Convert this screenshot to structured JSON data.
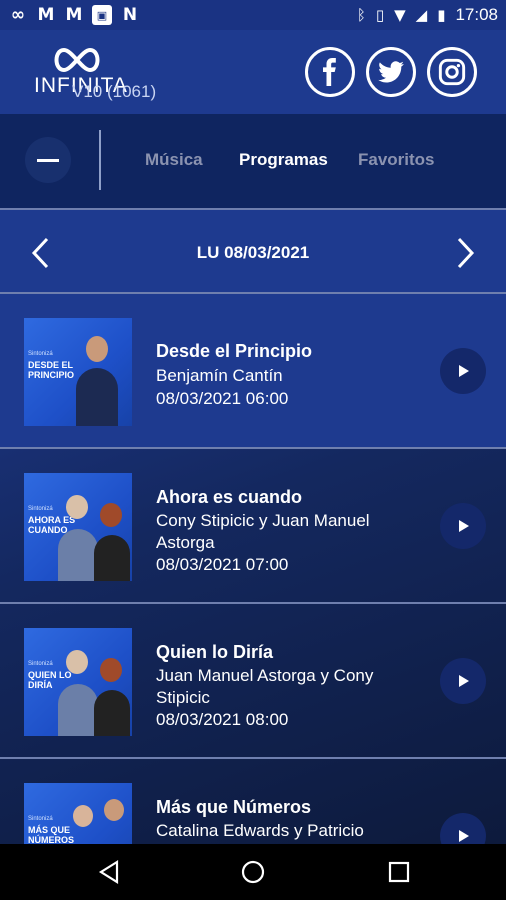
{
  "status": {
    "left_icons": [
      "infinity-icon",
      "gmail-icon",
      "gmail-icon",
      "image-icon",
      "n-icon"
    ],
    "right_icons": [
      "bluetooth-icon",
      "vibrate-icon",
      "wifi-icon",
      "signal-icon",
      "battery-icon"
    ],
    "time": "17:08"
  },
  "header": {
    "logo_text": "INFINITA",
    "version": "V10 (1061)",
    "social": [
      "facebook-icon",
      "twitter-icon",
      "instagram-icon"
    ]
  },
  "tabs": {
    "items": [
      {
        "label": "Música",
        "active": false
      },
      {
        "label": "Programas",
        "active": true
      },
      {
        "label": "Favoritos",
        "active": false
      }
    ]
  },
  "datebar": {
    "date": "LU 08/03/2021"
  },
  "programs": [
    {
      "thumb_small": "Sintonizá",
      "thumb_big": "DESDE EL PRINCIPIO",
      "title": "Desde el Principio",
      "hosts": "Benjamín Cantín",
      "datetime": "08/03/2021 06:00"
    },
    {
      "thumb_small": "Sintonizá",
      "thumb_big": "AHORA ES CUANDO",
      "title": "Ahora es cuando",
      "hosts": "Cony Stipicic y Juan Manuel Astorga",
      "datetime": "08/03/2021 07:00"
    },
    {
      "thumb_small": "Sintonizá",
      "thumb_big": "QUIEN LO DIRÍA",
      "title": "Quien lo Diría",
      "hosts": "Juan Manuel Astorga y Cony Stipicic",
      "datetime": "08/03/2021 08:00"
    },
    {
      "thumb_small": "Sintonizá",
      "thumb_big": "MÁS QUE NÚMEROS",
      "title": "Más que Números",
      "hosts": "Catalina Edwards y Patricio",
      "datetime": ""
    }
  ],
  "colors": {
    "header_bg": "#1e3a8f",
    "tabs_bg": "#0f2560",
    "accent_play": "#14286a"
  }
}
